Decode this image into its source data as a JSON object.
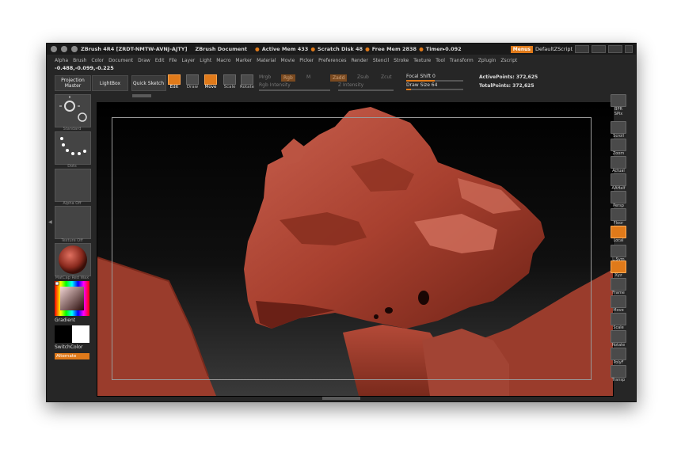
{
  "titlebar": {
    "app": "ZBrush 4R4 [ZRDT-NMTW-AVNJ-AJTY]",
    "doc": "ZBrush Document",
    "active_mem": "Active Mem 433",
    "scratch_disk": "Scratch Disk 48",
    "free_mem": "Free Mem 2838",
    "timer": "Timer▸0.092",
    "menus_label": "Menus",
    "script_label": "DefaultZScript"
  },
  "coords": "-0.488,-0.099,-0.225",
  "menubar": [
    "Alpha",
    "Brush",
    "Color",
    "Document",
    "Draw",
    "Edit",
    "File",
    "Layer",
    "Light",
    "Macro",
    "Marker",
    "Material",
    "Movie",
    "Picker",
    "Preferences",
    "Render",
    "Stencil",
    "Stroke",
    "Texture",
    "Tool",
    "Transform",
    "Zplugin",
    "Zscript"
  ],
  "toolbar": {
    "projection_master": "Projection Master",
    "lightbox": "LightBox",
    "quick_sketch": "Quick Sketch",
    "tools": [
      {
        "label": "Edit",
        "on": true
      },
      {
        "label": "Draw",
        "on": false
      },
      {
        "label": "Move",
        "on": true
      },
      {
        "label": "Scale",
        "on": false
      },
      {
        "label": "Rotate",
        "on": false
      }
    ],
    "mrgb": "Mrgb",
    "rgb": "Rgb",
    "m": "M",
    "rgb_intensity": "Rgb Intensity",
    "zadd": "Zadd",
    "zsub": "Zsub",
    "zcut": "Zcut",
    "z_intensity": "Z Intensity",
    "focal_shift": "Focal Shift 0",
    "draw_size": "Draw Size 64",
    "active_points": "ActivePoints: 372,625",
    "total_points": "TotalPoints: 372,625"
  },
  "leftshelf": {
    "thumbs": [
      "Standard",
      "Dots",
      "Alpha Off",
      "Texture Off",
      "MatCap Red Wax"
    ],
    "gradient": "Gradient",
    "switch_color": "SwitchColor",
    "alternate": "Alternate"
  },
  "rightshelf": [
    {
      "label": "BPR",
      "on": false
    },
    {
      "label": "SPix",
      "on": false
    },
    {
      "label": "Scroll",
      "on": false
    },
    {
      "label": "Zoom",
      "on": false
    },
    {
      "label": "Actual",
      "on": false
    },
    {
      "label": "AAHalf",
      "on": false
    },
    {
      "label": "Persp",
      "on": false
    },
    {
      "label": "Floor",
      "on": false
    },
    {
      "label": "Local",
      "on": true
    },
    {
      "label": "L.Sym",
      "on": false
    },
    {
      "label": "Xyz",
      "on": true
    },
    {
      "label": "Frame",
      "on": false
    },
    {
      "label": "Move",
      "on": false
    },
    {
      "label": "Scale",
      "on": false
    },
    {
      "label": "Rotate",
      "on": false
    },
    {
      "label": "PolyF",
      "on": false
    },
    {
      "label": "Transp",
      "on": false
    }
  ],
  "colors": {
    "accent": "#e07a1a",
    "mesh": "#b4483a",
    "bg": "#262626"
  }
}
